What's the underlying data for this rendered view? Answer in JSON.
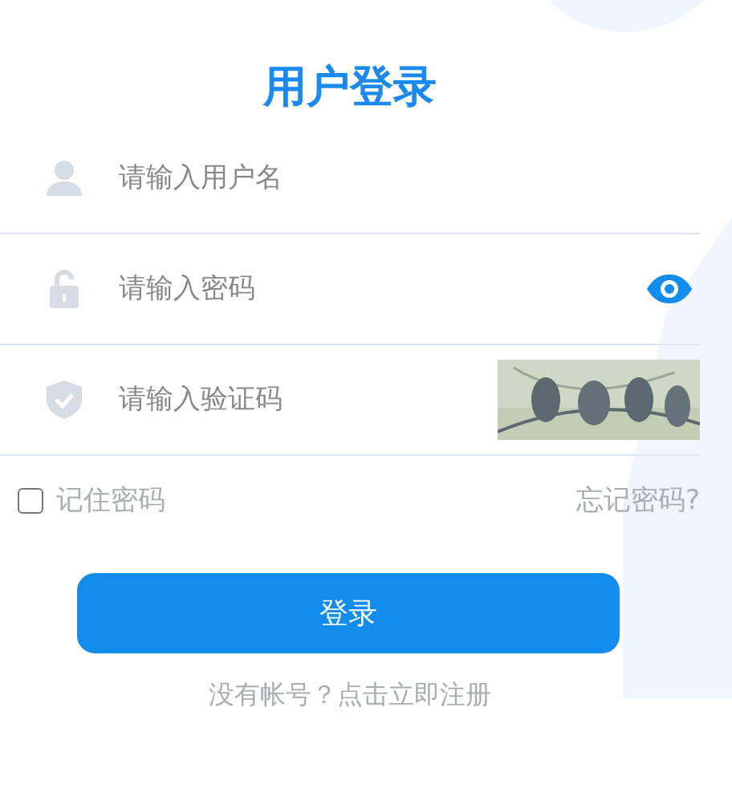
{
  "title": "用户登录",
  "fields": [
    {
      "kind": "username",
      "placeholder": "请输入用户名"
    },
    {
      "kind": "password",
      "placeholder": "请输入密码"
    },
    {
      "kind": "captcha",
      "placeholder": "请输入验证码"
    }
  ],
  "remember": {
    "label": "记住密码",
    "checked": false
  },
  "forgot_link": "忘记密码?",
  "login_button": "登录",
  "register_link": "没有帐号？点击立即注册"
}
